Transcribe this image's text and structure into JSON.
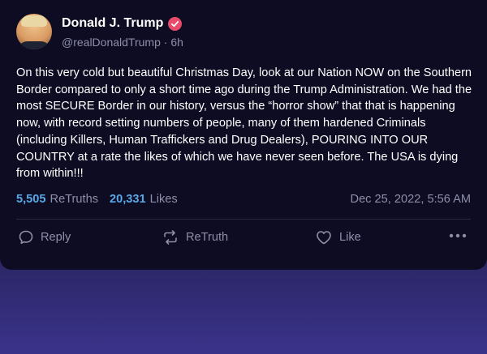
{
  "author": {
    "display_name": "Donald J. Trump",
    "handle": "@realDonaldTrump",
    "separator": "·",
    "time_ago": "6h",
    "verified_color": "#e84a6a"
  },
  "post": {
    "text": "On this very cold but beautiful Christmas Day, look at our Nation NOW on the Southern Border compared to only a short time ago during the Trump Administration. We had the most SECURE Border in our history, versus the “horror show” that that is happening now, with record setting numbers of people, many of them hardened Criminals (including Killers, Human Traffickers and Drug Dealers), POURING INTO OUR COUNTRY at a rate the likes of which we have never seen before. The USA is dying from within!!!"
  },
  "stats": {
    "retruths_count": "5,505",
    "retruths_label": "ReTruths",
    "likes_count": "20,331",
    "likes_label": "Likes",
    "timestamp": "Dec 25, 2022, 5:56 AM"
  },
  "actions": {
    "reply_label": "Reply",
    "retruth_label": "ReTruth",
    "like_label": "Like",
    "reply_icon": "speech-bubble-icon",
    "retruth_icon": "repost-arrows-icon",
    "like_icon": "heart-icon",
    "more_icon": "more-dots-icon"
  },
  "colors": {
    "accent_blue": "#5aa7e6",
    "muted_text": "#8e8ea8",
    "card_background": "#0d0c23"
  }
}
